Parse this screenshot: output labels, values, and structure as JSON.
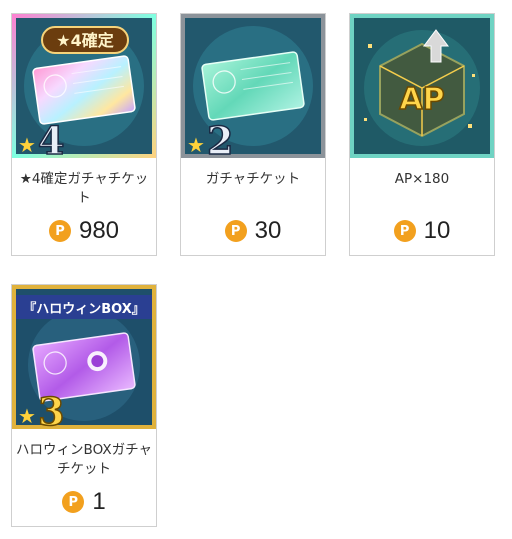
{
  "currency_symbol": "P",
  "items": [
    {
      "name": "★4確定ガチャチケット",
      "price": "980",
      "badge_label": "★4確定",
      "rarity": "4",
      "theme": "rainbow",
      "icon": "rainbow-gacha-ticket-icon"
    },
    {
      "name": "ガチャチケット",
      "price": "30",
      "rarity": "2",
      "theme": "teal",
      "icon": "teal-gacha-ticket-icon"
    },
    {
      "name": "AP×180",
      "price": "10",
      "icon_label": "AP",
      "theme": "gold",
      "icon": "ap-cube-icon"
    },
    {
      "name": "ハロウィンBOXガチャチケット",
      "price": "1",
      "badge_label": "『ハロウィンBOX』",
      "rarity": "3",
      "theme": "purple",
      "icon": "halloween-gacha-ticket-icon"
    }
  ]
}
